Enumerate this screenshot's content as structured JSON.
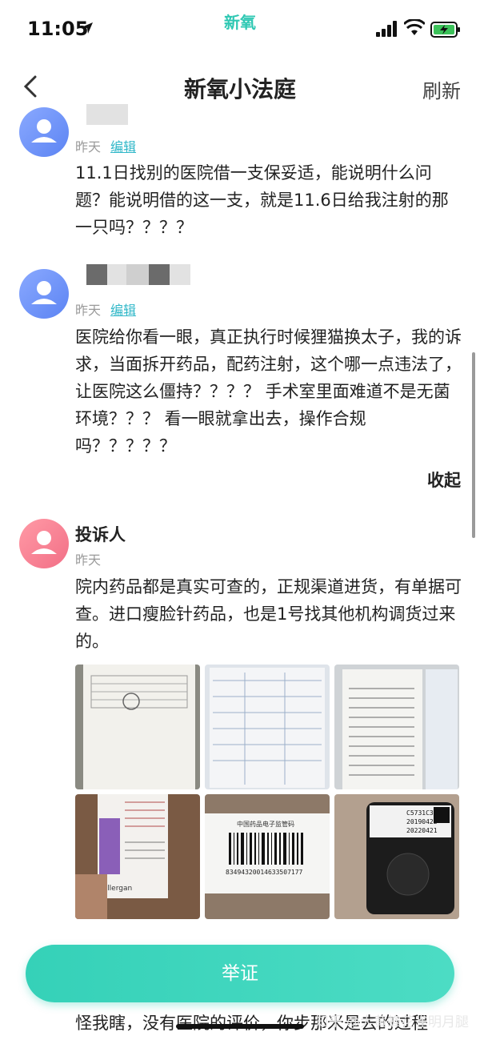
{
  "status_bar": {
    "time": "11:05",
    "brand": "新氧"
  },
  "nav": {
    "title": "新氧小法庭",
    "refresh_label": "刷新"
  },
  "comments": [
    {
      "meta": "昨天",
      "edit_label": "编辑",
      "text": "11.1日找别的医院借一支保妥适，能说明什么问题？能说明借的这一支，就是11.6日给我注射的那一只吗？？？？"
    },
    {
      "meta": "昨天",
      "edit_label": "编辑",
      "text": "医院给你看一眼，真正执行时候狸猫换太子，我的诉求，当面拆开药品，配药注射，这个哪一点违法了，让医院这么僵持？？？？ 手术室里面难道不是无菌环境？？？ 看一眼就拿出去，操作合规吗？？？？？",
      "collapse_label": "收起"
    },
    {
      "author": "投诉人",
      "meta": "昨天",
      "text": "院内药品都是真实可查的，正规渠道进货，有单据可查。进口瘦脸针药品，也是1号找其他机构调货过来的。"
    }
  ],
  "images": [
    {
      "name": "document-photo"
    },
    {
      "name": "invoice-photo"
    },
    {
      "name": "log-sheet-photo"
    },
    {
      "name": "vial-box-photo",
      "labels": [
        "Allergan"
      ]
    },
    {
      "name": "barcode-photo",
      "labels": [
        "中国药品电子监管码",
        "83494320014633507177"
      ]
    },
    {
      "name": "vial-label-photo",
      "labels": [
        "C5731C3",
        "20190422",
        "20220421"
      ]
    }
  ],
  "bottom": {
    "partial_text": "怪我瞎，没有医院的评价，你步那米是去的过程",
    "evidence_button": "举证",
    "watermark": "知乎 @大黄蜂花雀明月腿"
  },
  "colors": {
    "accent": "#35d1b8",
    "link": "#2fb7c8",
    "avatar_blue": "#6b8ef5",
    "avatar_pink": "#f27a8e"
  }
}
